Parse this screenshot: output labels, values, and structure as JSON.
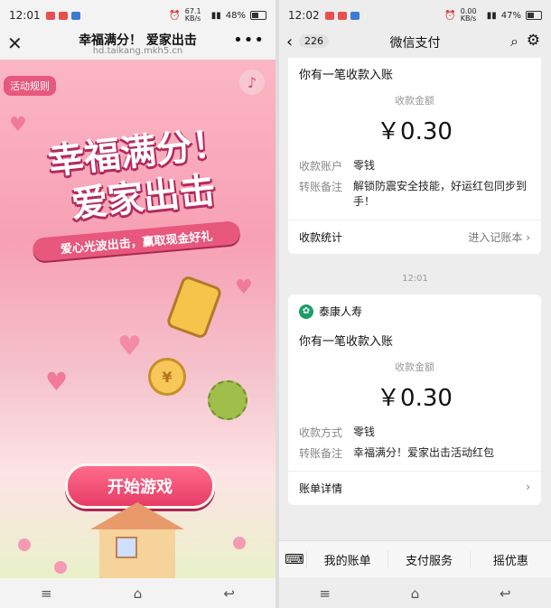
{
  "left": {
    "status": {
      "time": "12:01",
      "speed": "67.1 KB/s",
      "battery": "48%",
      "battery_level": 0.48
    },
    "header": {
      "title": "幸福满分！ 爱家出击",
      "url": "hd.taikang.mkh5.cn",
      "close_icon": "close-icon",
      "more_icon": "more-icon"
    },
    "game": {
      "rules_label": "活动规则",
      "title_line1": "幸福满分！",
      "title_line2": "爱家出击",
      "subtitle": "爱心光波出击，赢取现金好礼",
      "start_label": "开始游戏",
      "coin_symbol": "¥",
      "music_icon": "♪"
    },
    "nav": {
      "menu": "≡",
      "home": "⌂",
      "back": "↩"
    }
  },
  "right": {
    "status": {
      "time": "12:02",
      "speed": "0.00 KB/s",
      "battery": "47%",
      "battery_level": 0.47
    },
    "header": {
      "badge": "226",
      "title": "微信支付"
    },
    "card1": {
      "heading": "你有一笔收款入账",
      "amount_label": "收款金额",
      "amount": "￥0.30",
      "rows": [
        {
          "k": "收款账户",
          "v": "零钱"
        },
        {
          "k": "转账备注",
          "v": "解锁防震安全技能，好运红包同步到手！"
        }
      ],
      "footer_left": "收款统计",
      "footer_right": "进入记账本 ›"
    },
    "timestamp": "12:01",
    "card2": {
      "merchant": "泰康人寿",
      "heading": "你有一笔收款入账",
      "amount_label": "收款金额",
      "amount": "￥0.30",
      "rows": [
        {
          "k": "收款方式",
          "v": "零钱"
        },
        {
          "k": "转账备注",
          "v": "幸福满分！爱家出击活动红包"
        }
      ],
      "footer_left": "账单详情",
      "footer_right": "›"
    },
    "menu": {
      "keyboard": "⌨",
      "items": [
        "我的账单",
        "支付服务",
        "摇优惠"
      ]
    },
    "nav": {
      "menu": "≡",
      "home": "⌂",
      "back": "↩"
    }
  },
  "colors": {
    "pink": "#e8577c",
    "wechat_green": "#1a9e68"
  }
}
